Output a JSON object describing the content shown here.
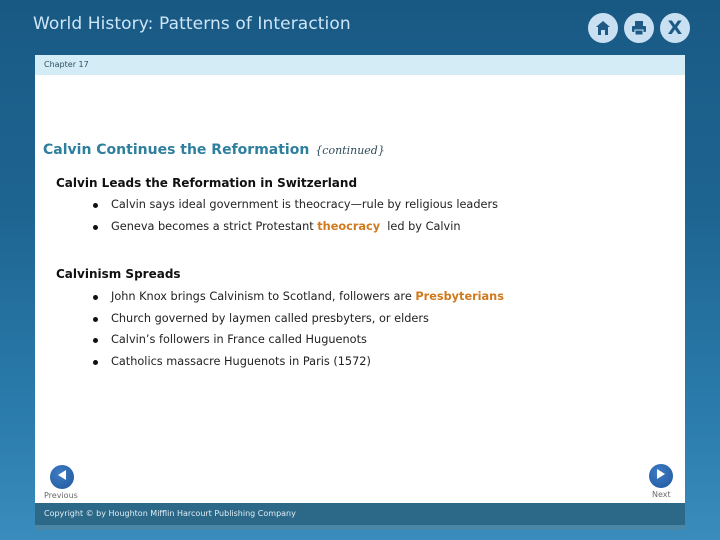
{
  "header": {
    "app_title": "World History: Patterns of Interaction",
    "icons": [
      {
        "name": "home-icon",
        "label": "Home"
      },
      {
        "name": "print-icon",
        "label": "Print"
      },
      {
        "name": "close-icon",
        "label": "X"
      }
    ]
  },
  "chapter": {
    "label": "Chapter 17"
  },
  "slide": {
    "title": "Calvin Continues the Reformation",
    "title_suffix": "{continued}",
    "sections": [
      {
        "heading": "Calvin Leads the Reformation in Switzerland",
        "bullets": [
          {
            "text": "Calvin says ideal government is theocracy—rule by religious leaders"
          },
          {
            "pre": "Geneva becomes a strict Protestant ",
            "highlight": "theocracy",
            "post": "  led by Calvin"
          }
        ]
      },
      {
        "heading": "Calvinism Spreads",
        "bullets": [
          {
            "pre": "John Knox brings Calvinism to Scotland, followers are ",
            "highlight": "Presbyterians",
            "post": ""
          },
          {
            "text": "Church governed by laymen called presbyters, or elders"
          },
          {
            "text": "Calvin’s followers in France called Huguenots"
          },
          {
            "text": "Catholics massacre Huguenots in Paris (1572)"
          }
        ]
      }
    ]
  },
  "nav": {
    "previous_label": "Previous",
    "next_label": "Next"
  },
  "footer": {
    "copyright": "Copyright © by Houghton Mifflin Harcourt Publishing Company"
  },
  "colors": {
    "frame": "#1b5d89",
    "chapter_bar": "#d3ecf5",
    "title": "#2e7f9e",
    "highlight": "#d07a1f",
    "footer": "#2c6887",
    "nav_button": "#2a62a8"
  }
}
